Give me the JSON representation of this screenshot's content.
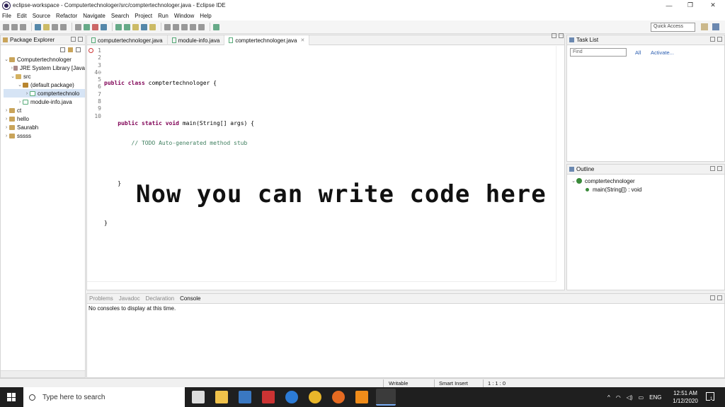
{
  "window": {
    "title": "eclipse-workspace - Computertechnologer/src/comptertechnologer.java - Eclipse IDE",
    "controls": [
      "—",
      "❐",
      "✕"
    ]
  },
  "menu": [
    "File",
    "Edit",
    "Source",
    "Refactor",
    "Navigate",
    "Search",
    "Project",
    "Run",
    "Window",
    "Help"
  ],
  "quick_access": "Quick Access",
  "package_explorer": {
    "title": "Package Explorer",
    "items": [
      {
        "label": "Computertechnologer",
        "twisty": "⌄"
      },
      {
        "label": "JRE System Library [Java",
        "twisty": "›"
      },
      {
        "label": "src",
        "twisty": "⌄"
      },
      {
        "label": "(default package)",
        "twisty": "⌄"
      },
      {
        "label": "comptertechnolo",
        "twisty": "›"
      },
      {
        "label": "module-info.java",
        "twisty": "›"
      },
      {
        "label": "ct",
        "twisty": "›"
      },
      {
        "label": "hello",
        "twisty": "›"
      },
      {
        "label": "Saurabh",
        "twisty": "›"
      },
      {
        "label": "sssss",
        "twisty": "›"
      }
    ]
  },
  "editor": {
    "tabs": [
      "computertechnologer.java",
      "module-info.java",
      "comptertechnologer.java"
    ],
    "line_numbers": [
      "1",
      "2",
      "3",
      "4⊖",
      "5",
      "6",
      "7",
      "8",
      "9",
      "10"
    ],
    "code_lines": [
      "",
      "public class comptertechnologer {",
      "",
      "    public static void main(String[] args) {",
      "        // TODO Auto-generated method stub",
      "",
      "    }",
      "",
      "}",
      ""
    ],
    "overlay": "Now you can write code here"
  },
  "task_list": {
    "title": "Task List",
    "find_placeholder": "Find",
    "all": "All",
    "activate": "Activate..."
  },
  "outline": {
    "title": "Outline",
    "class_name": "comptertechnologer",
    "method": "main(String[]) : void"
  },
  "console": {
    "tabs": [
      "Problems",
      "Javadoc",
      "Declaration",
      "Console"
    ],
    "message": "No consoles to display at this time."
  },
  "status": {
    "writable": "Writable",
    "insert": "Smart Insert",
    "position": "1 : 1 : 0"
  },
  "taskbar": {
    "search_placeholder": "Type here to search",
    "lang": "ENG",
    "time": "12:51 AM",
    "date": "1/12/2020",
    "notify": "1"
  }
}
